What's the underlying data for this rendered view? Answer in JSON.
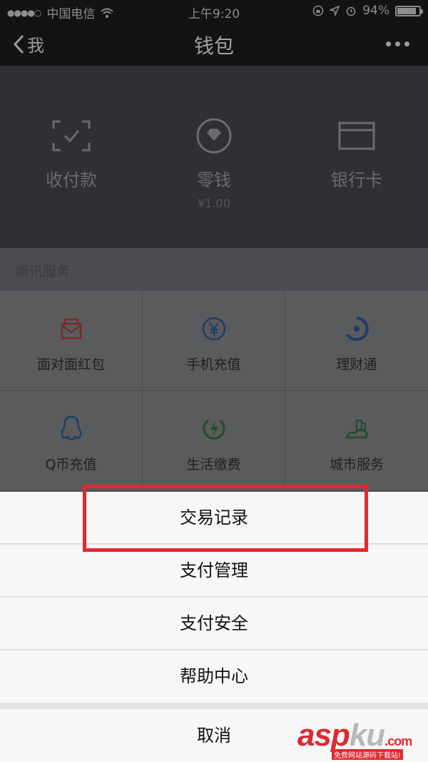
{
  "statusbar": {
    "carrier": "中国电信",
    "time": "上午9:20",
    "battery": "94%",
    "battery_level": 0.94
  },
  "navbar": {
    "back_label": "我",
    "title": "钱包"
  },
  "wallet": {
    "items": [
      {
        "label": "收付款",
        "icon": "scan-qr-icon"
      },
      {
        "label": "零钱",
        "sub": "¥1.00",
        "icon": "change-diamond-icon"
      },
      {
        "label": "银行卡",
        "icon": "bank-card-icon"
      }
    ]
  },
  "services": {
    "header": "腾讯服务",
    "items": [
      {
        "label": "面对面红包",
        "icon": "red-packet-icon",
        "color": "#7a2a2a"
      },
      {
        "label": "手机充值",
        "icon": "yuan-circle-icon",
        "color": "#1e3d66"
      },
      {
        "label": "理财通",
        "icon": "wealth-icon",
        "color": "#1e3d66"
      },
      {
        "label": "Q币充值",
        "icon": "qq-penguin-icon",
        "color": "#1e3d66"
      },
      {
        "label": "生活缴费",
        "icon": "bolt-icon",
        "color": "#1f4d2a"
      },
      {
        "label": "城市服务",
        "icon": "city-icon",
        "color": "#1f4d2a"
      }
    ]
  },
  "sheet": {
    "items": [
      "交易记录",
      "支付管理",
      "支付安全",
      "帮助中心"
    ],
    "cancel": "取消"
  },
  "watermark": {
    "asp": "asp",
    "ku": "ku",
    "com": ".com",
    "sub": "免费网站源码下载站!"
  },
  "colors": {
    "highlight": "#e2282f",
    "dim_bg": "#2f3033"
  }
}
